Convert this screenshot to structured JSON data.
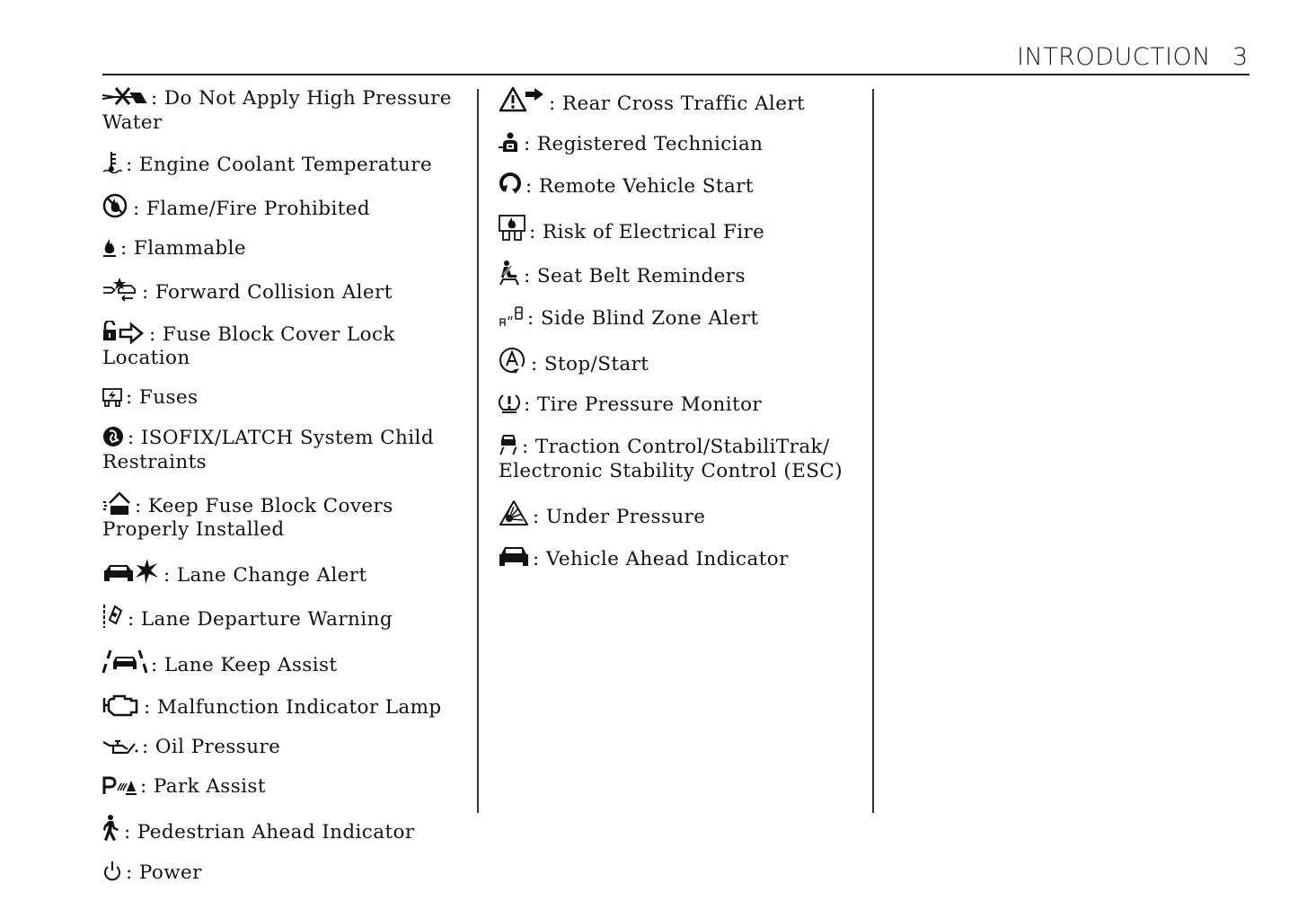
{
  "header": {
    "title": "INTRODUCTION",
    "page_number": "3"
  },
  "columns": [
    {
      "entries": [
        {
          "icon": "high-pressure-water-prohibited-icon",
          "label": ": Do Not Apply High Pressure Water"
        },
        {
          "icon": "engine-coolant-temperature-icon",
          "label": ": Engine Coolant Temperature"
        },
        {
          "icon": "flame-prohibited-icon",
          "label": ": Flame/Fire Prohibited"
        },
        {
          "icon": "flammable-icon",
          "label": ": Flammable"
        },
        {
          "icon": "forward-collision-alert-icon",
          "label": ": Forward Collision Alert"
        },
        {
          "icon": "fuse-block-cover-lock-icon",
          "label": ": Fuse Block Cover Lock Location"
        },
        {
          "icon": "fuses-icon",
          "label": ": Fuses"
        },
        {
          "icon": "isofix-latch-icon",
          "label": ": ISOFIX/LATCH System Child Restraints"
        },
        {
          "icon": "fuse-block-cover-installed-icon",
          "label": ": Keep Fuse Block Covers Properly Installed"
        },
        {
          "icon": "lane-change-alert-icon",
          "label": ": Lane Change Alert"
        },
        {
          "icon": "lane-departure-warning-icon",
          "label": ": Lane Departure Warning"
        },
        {
          "icon": "lane-keep-assist-icon",
          "label": ": Lane Keep Assist"
        },
        {
          "icon": "malfunction-indicator-lamp-icon",
          "label": ": Malfunction Indicator Lamp"
        },
        {
          "icon": "oil-pressure-icon",
          "label": ": Oil Pressure"
        },
        {
          "icon": "park-assist-icon",
          "label": ": Park Assist"
        },
        {
          "icon": "pedestrian-ahead-icon",
          "label": ": Pedestrian Ahead Indicator"
        },
        {
          "icon": "power-icon",
          "label": ": Power"
        }
      ]
    },
    {
      "entries": [
        {
          "icon": "rear-cross-traffic-alert-icon",
          "label": ": Rear Cross Traffic Alert"
        },
        {
          "icon": "registered-technician-icon",
          "label": ": Registered Technician"
        },
        {
          "icon": "remote-vehicle-start-icon",
          "label": ": Remote Vehicle Start"
        },
        {
          "icon": "electrical-fire-risk-icon",
          "label": ": Risk of Electrical Fire"
        },
        {
          "icon": "seat-belt-reminder-icon",
          "label": ": Seat Belt Reminders"
        },
        {
          "icon": "side-blind-zone-alert-icon",
          "label": ": Side Blind Zone Alert"
        },
        {
          "icon": "stop-start-icon",
          "label": ": Stop/Start"
        },
        {
          "icon": "tire-pressure-monitor-icon",
          "label": ": Tire Pressure Monitor"
        },
        {
          "icon": "traction-control-icon",
          "label": ": Traction Control/StabiliTrak/ Electronic Stability Control (ESC)"
        },
        {
          "icon": "under-pressure-icon",
          "label": ": Under Pressure"
        },
        {
          "icon": "vehicle-ahead-icon",
          "label": ": Vehicle Ahead Indicator"
        }
      ]
    }
  ]
}
